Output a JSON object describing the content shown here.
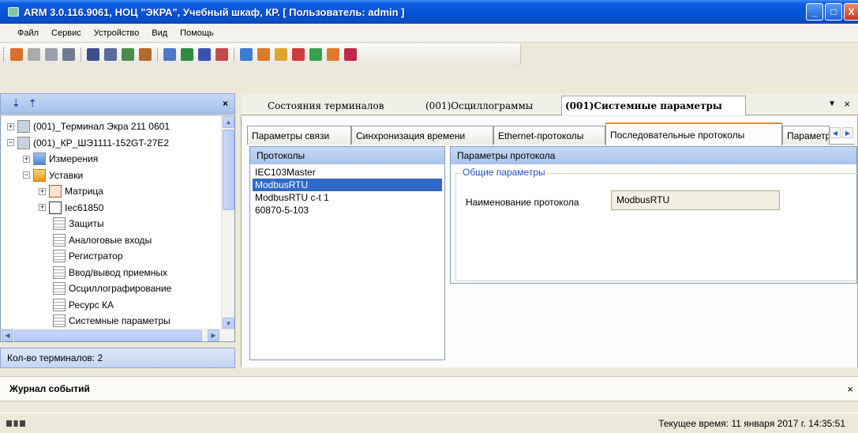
{
  "window": {
    "title": "ARM 3.0.116.9061, НОЦ \"ЭКРА\", Учебный шкаф, КР. [ Пользователь: admin ]",
    "minimize": "_",
    "maximize": "□",
    "close": "X"
  },
  "menu": {
    "items": [
      "Файл",
      "Сервис",
      "Устройство",
      "Вид",
      "Помощь"
    ]
  },
  "toolbar": {
    "icons": [
      {
        "name": "connect-icon",
        "color": "#d9702b"
      },
      {
        "name": "disconnect-icon",
        "color": "#aaaaaa"
      },
      {
        "name": "grid-icon",
        "color": "#9aa0b0"
      },
      {
        "name": "list-icon",
        "color": "#6f7a91"
      },
      {
        "name": "blocks-icon",
        "color": "#3b4e8c"
      },
      {
        "name": "table-icon",
        "color": "#5b6b9b"
      },
      {
        "name": "window-dropdown-icon",
        "color": "#4a8a4a"
      },
      {
        "name": "read-icon",
        "color": "#b56a2b"
      },
      {
        "name": "report-icon",
        "color": "#4d79c7"
      },
      {
        "name": "tree-icon",
        "color": "#2f8b3f"
      },
      {
        "name": "filter-icon",
        "color": "#3a52b4"
      },
      {
        "name": "tools-icon",
        "color": "#c44a4a"
      },
      {
        "name": "print-icon",
        "color": "#3f7bd4"
      },
      {
        "name": "edit-icon",
        "color": "#d97b2a"
      },
      {
        "name": "folder-icon",
        "color": "#e0a42c"
      },
      {
        "name": "chart-icon",
        "color": "#d23b3b"
      },
      {
        "name": "transfer-icon",
        "color": "#37a14a"
      },
      {
        "name": "settings-icon",
        "color": "#e07a2a"
      },
      {
        "name": "book-icon",
        "color": "#c0284a"
      }
    ]
  },
  "left_panel": {
    "close_label": "×",
    "tree": [
      {
        "label": "(001)_Терминал Экра 211 0601",
        "expander": "+",
        "icon": "term"
      },
      {
        "label": "(001)_КР_ШЭ1111-152GT-27Е2",
        "expander": "−",
        "icon": "term"
      },
      {
        "label": "Измерения",
        "expander": "+",
        "icon": "meas"
      },
      {
        "label": "Уставки",
        "expander": "−",
        "icon": "folder"
      },
      {
        "label": "Матрица",
        "expander": "+",
        "icon": "matrix"
      },
      {
        "label": "Iec61850",
        "expander": "+",
        "icon": "iec"
      },
      {
        "label": "Защиты",
        "expander": "",
        "icon": "page"
      },
      {
        "label": "Аналоговые входы",
        "expander": "",
        "icon": "page"
      },
      {
        "label": "Регистратор",
        "expander": "",
        "icon": "page"
      },
      {
        "label": "Ввод/вывод приемных",
        "expander": "",
        "icon": "page"
      },
      {
        "label": "Осциллографирование",
        "expander": "",
        "icon": "page"
      },
      {
        "label": "Ресурс КА",
        "expander": "",
        "icon": "page"
      },
      {
        "label": "Системные параметры",
        "expander": "",
        "icon": "page"
      }
    ],
    "terminal_count": "Кол-во терминалов: 2"
  },
  "doc_tabs": {
    "tabs": [
      "Состояния терминалов",
      "(001)Осциллограммы",
      "(001)Системные параметры"
    ],
    "active_index": 2,
    "dropdown_label": "▼",
    "close_label": "×"
  },
  "sub_tabs": {
    "tabs": [
      "Параметры связи",
      "Синхронизация времени",
      "Ethernet-протоколы",
      "Последовательные протоколы",
      "Параметры"
    ],
    "active_index": 3
  },
  "protocols": {
    "header": "Протоколы",
    "items": [
      "IEC103Master",
      "ModbusRTU",
      "ModbusRTU c-t 1",
      "60870-5-103"
    ],
    "selected_index": 1
  },
  "params": {
    "header": "Параметры протокола",
    "group_title": "Общие параметры",
    "field_label": "Наименование протокола",
    "field_value": "ModbusRTU"
  },
  "journal": {
    "title": "Журнал событий",
    "close_label": "×"
  },
  "status": {
    "time_text": "Текущее время: 11 января 2017 г. 14:35:51"
  }
}
